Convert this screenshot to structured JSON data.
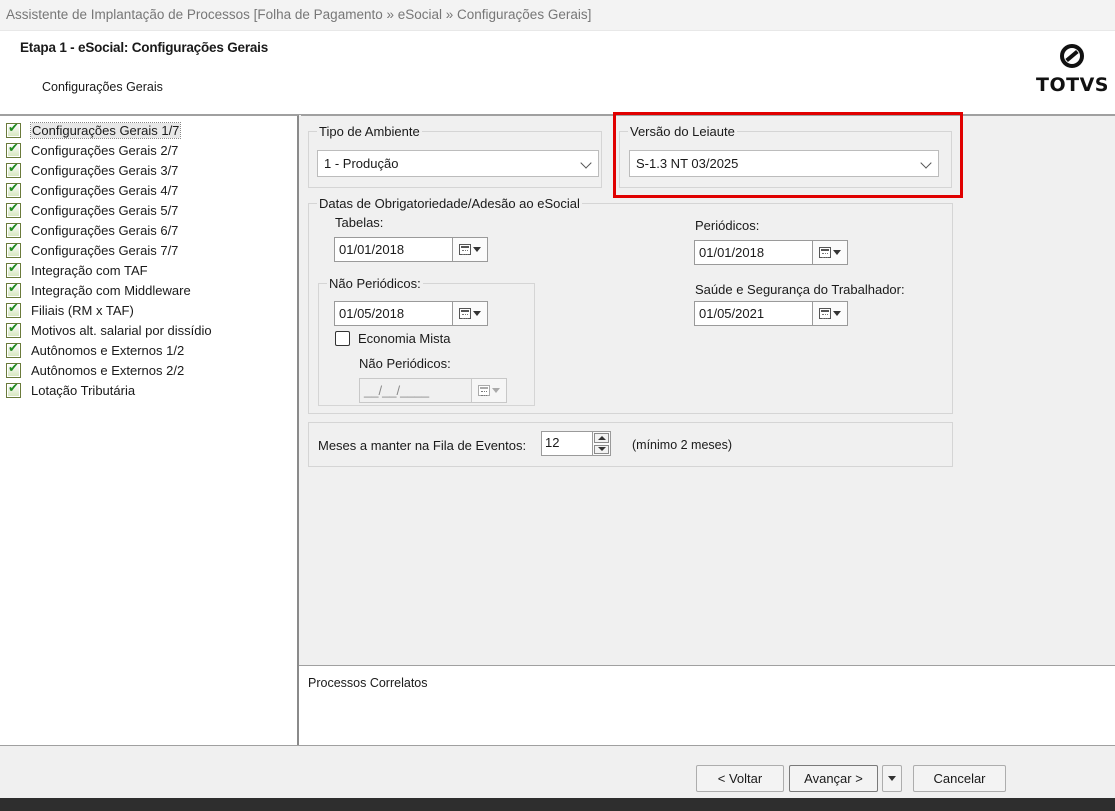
{
  "window": {
    "title": "Assistente de Implantação de Processos [Folha de Pagamento » eSocial » Configurações Gerais]"
  },
  "header": {
    "step_title": "Etapa 1 - eSocial: Configurações Gerais",
    "step_subtitle": "Configurações Gerais",
    "logo_text": "TOTVS"
  },
  "sidebar": {
    "items": [
      {
        "label": "Configurações Gerais 1/7",
        "selected": true
      },
      {
        "label": "Configurações Gerais 2/7"
      },
      {
        "label": "Configurações Gerais 3/7"
      },
      {
        "label": "Configurações Gerais 4/7"
      },
      {
        "label": "Configurações Gerais 5/7"
      },
      {
        "label": "Configurações Gerais 6/7"
      },
      {
        "label": "Configurações Gerais 7/7"
      },
      {
        "label": "Integração com TAF"
      },
      {
        "label": "Integração com Middleware"
      },
      {
        "label": "Filiais (RM x TAF)"
      },
      {
        "label": "Motivos alt. salarial por dissídio"
      },
      {
        "label": "Autônomos e Externos 1/2"
      },
      {
        "label": "Autônomos e Externos 2/2"
      },
      {
        "label": "Lotação Tributária"
      }
    ]
  },
  "form": {
    "ambiente": {
      "legend": "Tipo de Ambiente",
      "value": "1 - Produção"
    },
    "leiaute": {
      "legend": "Versão do Leiaute",
      "value": "S-1.3 NT 03/2025"
    },
    "datas": {
      "legend": "Datas de Obrigatoriedade/Adesão ao eSocial",
      "tabelas_label": "Tabelas:",
      "tabelas_value": "01/01/2018",
      "periodicos_label": "Periódicos:",
      "periodicos_value": "01/01/2018",
      "nao_periodicos_legend": "Não Periódicos:",
      "nao_periodicos_value": "01/05/2018",
      "economia_mista_label": "Economia Mista",
      "economia_mista_checked": false,
      "em_nao_periodicos_label": "Não Periódicos:",
      "em_nao_periodicos_value": "__/__/____",
      "sst_label": "Saúde e Segurança do Trabalhador:",
      "sst_value": "01/05/2021"
    },
    "fila": {
      "label": "Meses a manter na Fila de Eventos:",
      "value": "12",
      "hint": "(mínimo 2 meses)"
    }
  },
  "correlated": {
    "title": "Processos Correlatos"
  },
  "footer": {
    "back_label": "< Voltar",
    "next_label": "Avançar >",
    "cancel_label": "Cancelar"
  },
  "colors": {
    "highlight": "#e00000",
    "check": "#1e8a1e"
  }
}
